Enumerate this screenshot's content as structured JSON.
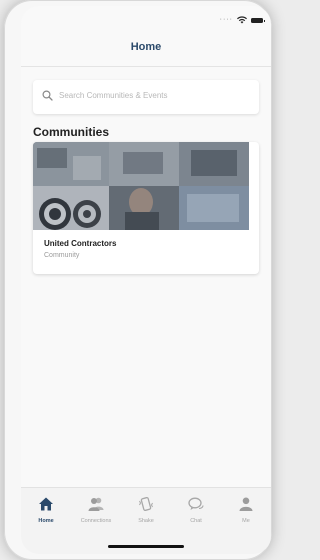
{
  "status_bar": {
    "signal": "····"
  },
  "nav": {
    "title": "Home"
  },
  "search": {
    "placeholder": "Search Communities & Events"
  },
  "communities": {
    "section_title": "Communities",
    "items": [
      {
        "title": "United Contractors",
        "subtitle": "Community"
      }
    ]
  },
  "tab_bar": {
    "tabs": [
      {
        "label": "Home",
        "icon": "home-icon",
        "active": true
      },
      {
        "label": "Connections",
        "icon": "people-icon",
        "active": false
      },
      {
        "label": "Shake",
        "icon": "shake-icon",
        "active": false
      },
      {
        "label": "Chat",
        "icon": "chat-icon",
        "active": false
      },
      {
        "label": "Me",
        "icon": "person-icon",
        "active": false
      }
    ]
  },
  "colors": {
    "accent": "#2b4a6b",
    "inactive": "#a5a5a5"
  }
}
